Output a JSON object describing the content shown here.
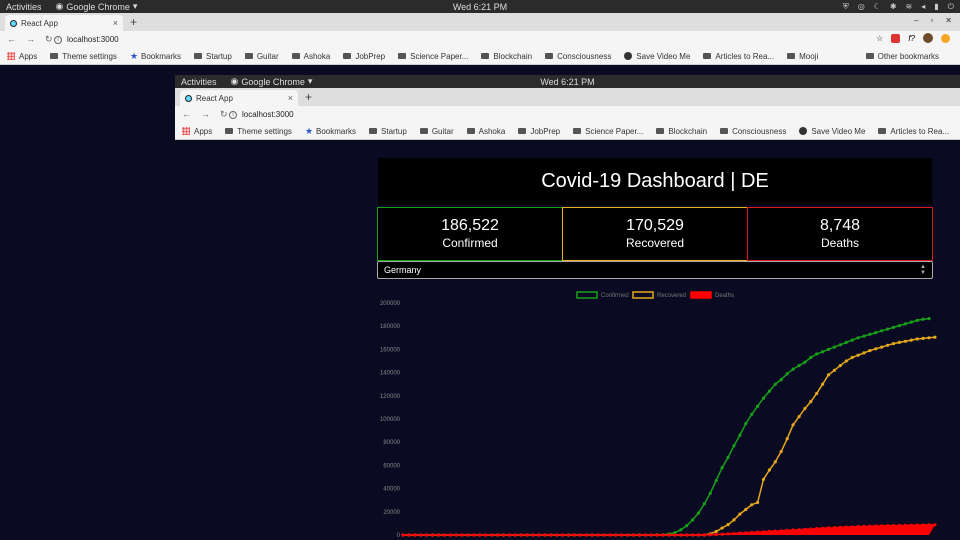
{
  "os": {
    "activities": "Activities",
    "app_name": "Google Chrome",
    "clock": "Wed  6:21 PM"
  },
  "browser": {
    "tab_title": "React App",
    "url": "localhost:3000",
    "bookmarks": [
      "Apps",
      "Theme settings",
      "Bookmarks",
      "Startup",
      "Guitar",
      "Ashoka",
      "JobPrep",
      "Science Paper...",
      "Blockchain",
      "Consciousness",
      "Save Video Me",
      "Articles to Rea...",
      "Mooji"
    ],
    "other_bookmarks": "Other bookmarks"
  },
  "dashboard": {
    "title": "Covid-19 Dashboard | DE",
    "confirmed": {
      "value": "186,522",
      "label": "Confirmed"
    },
    "recovered": {
      "value": "170,529",
      "label": "Recovered"
    },
    "deaths": {
      "value": "8,748",
      "label": "Deaths"
    },
    "country": "Germany"
  },
  "colors": {
    "confirmed": "#19a019",
    "recovered": "#e5a81c",
    "deaths": "#ff0000",
    "background": "#0a0a23"
  },
  "chart_data": {
    "type": "line",
    "ylim": [
      0,
      200000
    ],
    "yticks": [
      0,
      20000,
      40000,
      60000,
      80000,
      100000,
      120000,
      140000,
      160000,
      180000,
      200000
    ],
    "x_count": 90,
    "series": [
      {
        "name": "Confirmed",
        "color": "#19a019",
        "values": [
          0,
          0,
          0,
          0,
          0,
          0,
          0,
          0,
          0,
          0,
          0,
          0,
          0,
          0,
          0,
          0,
          0,
          0,
          0,
          0,
          0,
          0,
          0,
          0,
          0,
          0,
          0,
          0,
          0,
          0,
          0,
          0,
          0,
          0,
          0,
          0,
          0,
          0,
          0,
          0,
          0,
          0,
          0,
          100,
          300,
          900,
          2000,
          4500,
          8000,
          13000,
          19000,
          27000,
          36000,
          47000,
          58000,
          67000,
          77000,
          86000,
          96000,
          104000,
          111000,
          118000,
          124000,
          130000,
          134000,
          139000,
          143000,
          146000,
          149000,
          153000,
          156000,
          158000,
          160000,
          162000,
          164000,
          166000,
          168000,
          170000,
          171500,
          173000,
          174500,
          176000,
          177500,
          179000,
          180500,
          182000,
          183500,
          185000,
          186000,
          186522
        ]
      },
      {
        "name": "Recovered",
        "color": "#e5a81c",
        "values": [
          0,
          0,
          0,
          0,
          0,
          0,
          0,
          0,
          0,
          0,
          0,
          0,
          0,
          0,
          0,
          0,
          0,
          0,
          0,
          0,
          0,
          0,
          0,
          0,
          0,
          0,
          0,
          0,
          0,
          0,
          0,
          0,
          0,
          0,
          0,
          0,
          0,
          0,
          0,
          0,
          0,
          0,
          0,
          0,
          0,
          0,
          0,
          0,
          0,
          0,
          0,
          0,
          1000,
          3000,
          6000,
          9000,
          13000,
          18000,
          22000,
          26000,
          28000,
          48000,
          56000,
          63000,
          72000,
          83000,
          95000,
          102000,
          109000,
          115000,
          122000,
          130000,
          138000,
          142000,
          146000,
          150000,
          153000,
          155000,
          157000,
          159000,
          160500,
          162000,
          163500,
          165000,
          166000,
          167000,
          168000,
          169000,
          169500,
          170000,
          170529
        ]
      },
      {
        "name": "Deaths",
        "color": "#ff0000",
        "values": [
          0,
          0,
          0,
          0,
          0,
          0,
          0,
          0,
          0,
          0,
          0,
          0,
          0,
          0,
          0,
          0,
          0,
          0,
          0,
          0,
          0,
          0,
          0,
          0,
          0,
          0,
          0,
          0,
          0,
          0,
          0,
          0,
          0,
          0,
          0,
          0,
          0,
          0,
          0,
          0,
          0,
          0,
          0,
          0,
          0,
          0,
          0,
          0,
          0,
          0,
          50,
          100,
          200,
          400,
          700,
          1000,
          1300,
          1600,
          1900,
          2200,
          2500,
          2800,
          3100,
          3400,
          3700,
          4000,
          4300,
          4600,
          4900,
          5200,
          5500,
          5800,
          6100,
          6300,
          6600,
          6800,
          7000,
          7200,
          7400,
          7600,
          7800,
          7900,
          8000,
          8100,
          8200,
          8300,
          8400,
          8500,
          8600,
          8700,
          8748
        ]
      }
    ]
  }
}
